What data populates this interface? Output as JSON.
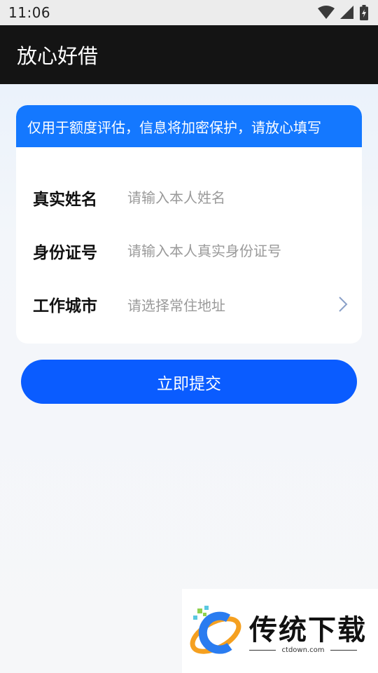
{
  "status_bar": {
    "time": "11:06",
    "icons": [
      "wifi-icon",
      "cellular-signal-icon",
      "battery-charging-icon"
    ]
  },
  "app_bar": {
    "title": "放心好借"
  },
  "card": {
    "banner": "仅用于额度评估，信息将加密保护，请放心填写",
    "fields": {
      "name": {
        "label": "真实姓名",
        "placeholder": "请输入本人姓名"
      },
      "id_number": {
        "label": "身份证号",
        "placeholder": "请输入本人真实身份证号"
      },
      "city": {
        "label": "工作城市",
        "placeholder": "请选择常住地址"
      }
    }
  },
  "submit_label": "立即提交",
  "watermark": {
    "brand": "传统下载",
    "url": "ctdown.com"
  },
  "colors": {
    "app_bar": "#141414",
    "banner": "#1478ff",
    "button": "#0a5cff",
    "placeholder": "#9a9a9a"
  }
}
